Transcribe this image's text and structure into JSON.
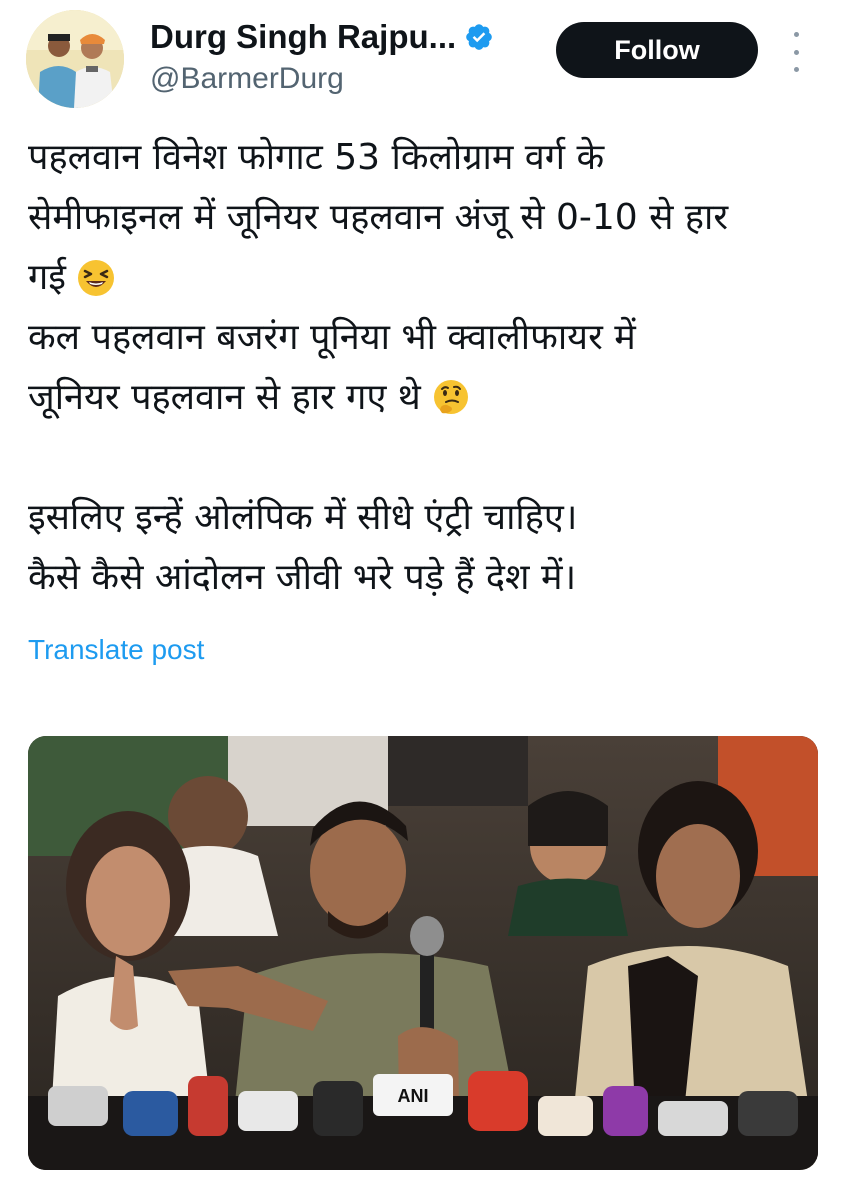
{
  "author": {
    "display_name": "Durg Singh Rajpu...",
    "handle": "@BarmerDurg",
    "verified": true,
    "avatar_icon": "profile-photo-avatar"
  },
  "actions": {
    "follow_label": "Follow",
    "more_icon": "more-vertical-icon"
  },
  "post": {
    "lines": [
      "पहलवान विनेश फोगाट 53 किलोग्राम वर्ग के",
      "सेमीफाइनल में जूनियर पहलवान अंजू से 0-10 से हार",
      "गई",
      "कल पहलवान बजरंग पूनिया भी क्वालीफायर में",
      "जूनियर पहलवान से हार गए थे",
      "",
      "इसलिए इन्हें ओलंपिक में सीधे एंट्री चाहिए।",
      "कैसे कैसे आंदोलन जीवी भरे पड़े हैं देश में।"
    ],
    "emojis": [
      "laughing-emoji",
      "thinking-emoji"
    ],
    "translate_label": "Translate post"
  },
  "media": {
    "kind": "photo",
    "description_icon": "press-conference-photo",
    "mic_logo_text": "ANI"
  },
  "colors": {
    "text": "#0f1419",
    "secondary": "#536471",
    "link": "#1d9bf0",
    "follow_bg": "#0f1419",
    "verified": "#1d9bf0"
  }
}
